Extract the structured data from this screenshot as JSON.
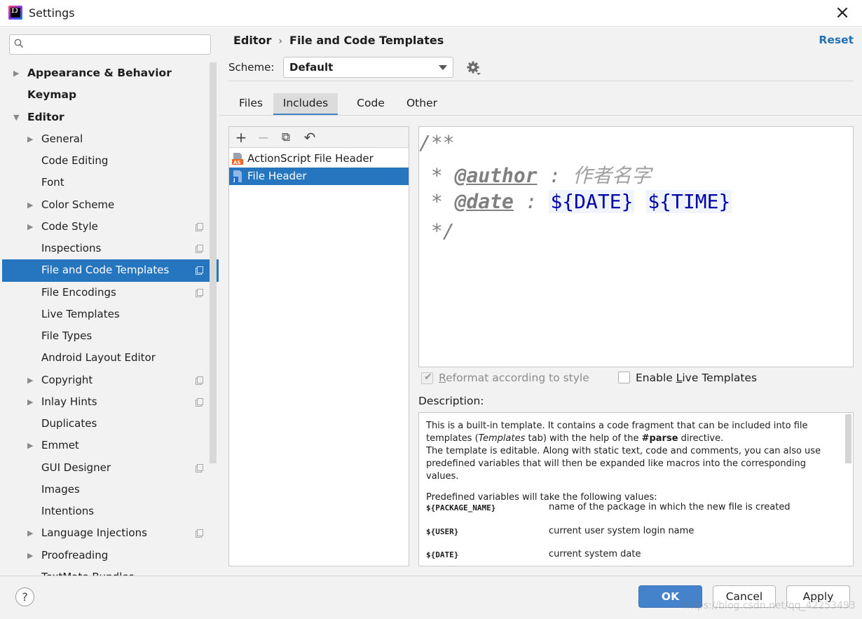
{
  "window": {
    "title": "Settings",
    "close_icon": "×"
  },
  "search": {
    "placeholder": "",
    "value": ""
  },
  "sidebar": {
    "items": [
      {
        "label": "Appearance & Behavior",
        "level": 0,
        "arrow": "▶",
        "project": false
      },
      {
        "label": "Keymap",
        "level": 0,
        "arrow": "",
        "project": false
      },
      {
        "label": "Editor",
        "level": 0,
        "arrow": "▼",
        "project": false
      },
      {
        "label": "General",
        "level": 1,
        "arrow": "▶",
        "project": false
      },
      {
        "label": "Code Editing",
        "level": 1,
        "arrow": "",
        "project": false
      },
      {
        "label": "Font",
        "level": 1,
        "arrow": "",
        "project": false
      },
      {
        "label": "Color Scheme",
        "level": 1,
        "arrow": "▶",
        "project": false
      },
      {
        "label": "Code Style",
        "level": 1,
        "arrow": "▶",
        "project": true
      },
      {
        "label": "Inspections",
        "level": 1,
        "arrow": "",
        "project": true
      },
      {
        "label": "File and Code Templates",
        "level": 1,
        "arrow": "",
        "project": true,
        "selected": true
      },
      {
        "label": "File Encodings",
        "level": 1,
        "arrow": "",
        "project": true
      },
      {
        "label": "Live Templates",
        "level": 1,
        "arrow": "",
        "project": false
      },
      {
        "label": "File Types",
        "level": 1,
        "arrow": "",
        "project": false
      },
      {
        "label": "Android Layout Editor",
        "level": 1,
        "arrow": "",
        "project": false
      },
      {
        "label": "Copyright",
        "level": 1,
        "arrow": "▶",
        "project": true
      },
      {
        "label": "Inlay Hints",
        "level": 1,
        "arrow": "▶",
        "project": true
      },
      {
        "label": "Duplicates",
        "level": 1,
        "arrow": "",
        "project": false
      },
      {
        "label": "Emmet",
        "level": 1,
        "arrow": "▶",
        "project": false
      },
      {
        "label": "GUI Designer",
        "level": 1,
        "arrow": "",
        "project": true
      },
      {
        "label": "Images",
        "level": 1,
        "arrow": "",
        "project": false
      },
      {
        "label": "Intentions",
        "level": 1,
        "arrow": "",
        "project": false
      },
      {
        "label": "Language Injections",
        "level": 1,
        "arrow": "▶",
        "project": true
      },
      {
        "label": "Proofreading",
        "level": 1,
        "arrow": "▶",
        "project": false
      },
      {
        "label": "TextMate Bundles",
        "level": 1,
        "arrow": "",
        "project": false
      }
    ]
  },
  "header": {
    "breadcrumb_parent": "Editor",
    "breadcrumb_sep": "›",
    "breadcrumb_current": "File and Code Templates",
    "reset_label": "Reset"
  },
  "scheme": {
    "label": "Scheme:",
    "value": "Default"
  },
  "tabs": [
    {
      "label": "Files",
      "active": false
    },
    {
      "label": "Includes",
      "active": true
    },
    {
      "label": "Code",
      "active": false
    },
    {
      "label": "Other",
      "active": false
    }
  ],
  "toolbar": {
    "add": "+",
    "remove": "−",
    "copy": "⧉",
    "reset": "↶"
  },
  "templates": [
    {
      "label": "ActionScript File Header",
      "icon": "as-file-icon",
      "badge": "AS",
      "selected": false
    },
    {
      "label": "File Header",
      "icon": "java-file-icon",
      "badge": "J",
      "selected": true
    }
  ],
  "editor": {
    "line1": "/**",
    "line2_prefix": " * ",
    "line2_tag": "@author",
    "line2_sep": " : ",
    "line2_value": "作者名字",
    "line3_prefix": " * ",
    "line3_tag": "@date",
    "line3_sep": " : ",
    "line3_var1": "${DATE}",
    "line3_var2": "${TIME}",
    "line4": " */"
  },
  "options": {
    "reformat_label_pre": "",
    "reformat_label_mnemonic": "R",
    "reformat_label_post": "eformat according to style",
    "reformat_checked": true,
    "live_label_pre": "Enable ",
    "live_label_mnemonic": "L",
    "live_label_post": "ive Templates",
    "live_checked": false
  },
  "description": {
    "label": "Description:",
    "p1_a": "This is a built-in template. It contains a code fragment that can be included into file templates (",
    "p1_italic": "Templates",
    "p1_b": " tab) with the help of the ",
    "p1_bold": "#parse",
    "p1_c": " directive.",
    "p2": "The template is editable. Along with static text, code and comments, you can also use predefined variables that will then be expanded like macros into the corresponding values.",
    "p3": "Predefined variables will take the following values:",
    "variables": [
      {
        "name": "${PACKAGE_NAME}",
        "desc": "name of the package in which the new file is created"
      },
      {
        "name": "${USER}",
        "desc": "current user system login name"
      },
      {
        "name": "${DATE}",
        "desc": "current system date"
      }
    ]
  },
  "buttons": {
    "help": "?",
    "ok": "OK",
    "cancel": "Cancel",
    "apply": "Apply"
  },
  "watermark": "https://blog.csdn.net/qq_42253493"
}
